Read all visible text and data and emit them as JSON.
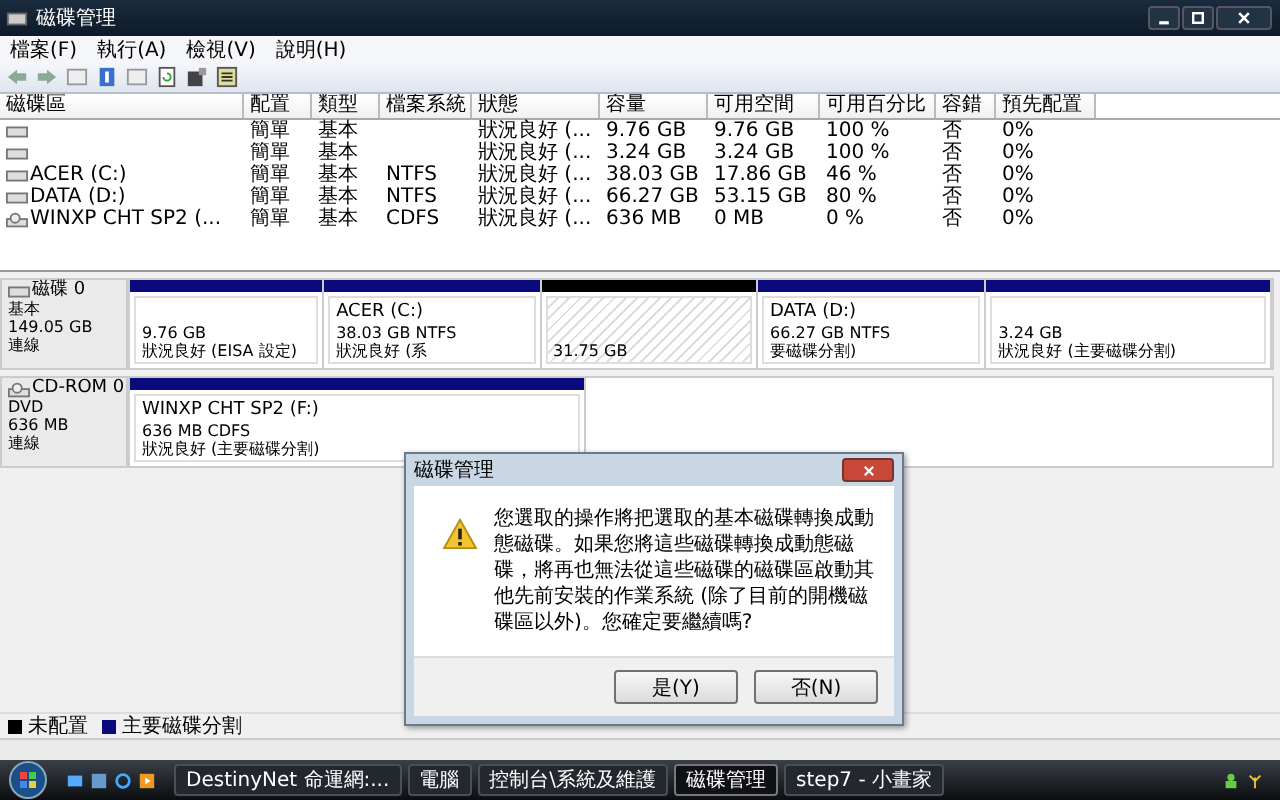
{
  "window": {
    "title": "磁碟管理"
  },
  "menu": [
    "檔案(F)",
    "執行(A)",
    "檢視(V)",
    "說明(H)"
  ],
  "table": {
    "columns": [
      "磁碟區",
      "配置",
      "類型",
      "檔案系統",
      "狀態",
      "容量",
      "可用空間",
      "可用百分比",
      "容錯",
      "預先配置"
    ],
    "rows": [
      {
        "kind": "volume",
        "cells": [
          "",
          "簡單",
          "基本",
          "",
          "狀況良好 (...",
          "9.76 GB",
          "9.76 GB",
          "100 %",
          "否",
          "0%"
        ]
      },
      {
        "kind": "volume",
        "cells": [
          "",
          "簡單",
          "基本",
          "",
          "狀況良好 (...",
          "3.24 GB",
          "3.24 GB",
          "100 %",
          "否",
          "0%"
        ]
      },
      {
        "kind": "volume",
        "cells": [
          "ACER (C:)",
          "簡單",
          "基本",
          "NTFS",
          "狀況良好 (...",
          "38.03 GB",
          "17.86 GB",
          "46 %",
          "否",
          "0%"
        ]
      },
      {
        "kind": "volume",
        "cells": [
          "DATA (D:)",
          "簡單",
          "基本",
          "NTFS",
          "狀況良好 (...",
          "66.27 GB",
          "53.15 GB",
          "80 %",
          "否",
          "0%"
        ]
      },
      {
        "kind": "cdrom",
        "cells": [
          "WINXP CHT SP2 (...",
          "簡單",
          "基本",
          "CDFS",
          "狀況良好 (...",
          "636 MB",
          "0 MB",
          "0 %",
          "否",
          "0%"
        ]
      }
    ]
  },
  "disks": [
    {
      "kind": "hdd",
      "name": "磁碟 0",
      "lines": [
        "基本",
        "149.05 GB",
        "連線"
      ],
      "partitions": [
        {
          "kind": "primary",
          "lines": [
            "9.76 GB",
            "狀況良好 (EISA 設定)"
          ]
        },
        {
          "kind": "primary",
          "title": "ACER  (C:)",
          "lines": [
            "38.03 GB NTFS",
            "狀況良好 (系"
          ]
        },
        {
          "kind": "unallocated",
          "lines": [
            "31.75 GB"
          ]
        },
        {
          "kind": "primary",
          "title": "DATA  (D:)",
          "lines": [
            "66.27 GB NTFS",
            "要磁碟分割)"
          ]
        },
        {
          "kind": "primary",
          "lines": [
            "3.24 GB",
            "狀況良好 (主要磁碟分割)"
          ]
        }
      ]
    },
    {
      "kind": "cdrom",
      "name": "CD-ROM 0",
      "lines": [
        "DVD",
        "636 MB",
        "連線"
      ],
      "partitions": [
        {
          "kind": "primary",
          "title": "WINXP CHT SP2  (F:)",
          "lines": [
            "636 MB CDFS",
            "狀況良好 (主要磁碟分割)"
          ]
        }
      ]
    }
  ],
  "legend": [
    {
      "kind": "unallocated",
      "label": "未配置"
    },
    {
      "kind": "primary",
      "label": "主要磁碟分割"
    }
  ],
  "dialog": {
    "title": "磁碟管理",
    "message": "您選取的操作將把選取的基本磁碟轉換成動態磁碟。如果您將這些磁碟轉換成動態磁碟，將再也無法從這些磁碟的磁碟區啟動其他先前安裝的作業系統 (除了目前的開機磁碟區以外)。您確定要繼續嗎?",
    "buttons": [
      "是(Y)",
      "否(N)"
    ]
  },
  "taskbar": {
    "tasks": [
      {
        "label": "DestinyNet 命運網:...",
        "selected": false
      },
      {
        "label": "電腦",
        "selected": false
      },
      {
        "label": "控制台\\系統及維護",
        "selected": false
      },
      {
        "label": "磁碟管理",
        "selected": true
      },
      {
        "label": "step7 - 小畫家",
        "selected": false
      }
    ]
  }
}
